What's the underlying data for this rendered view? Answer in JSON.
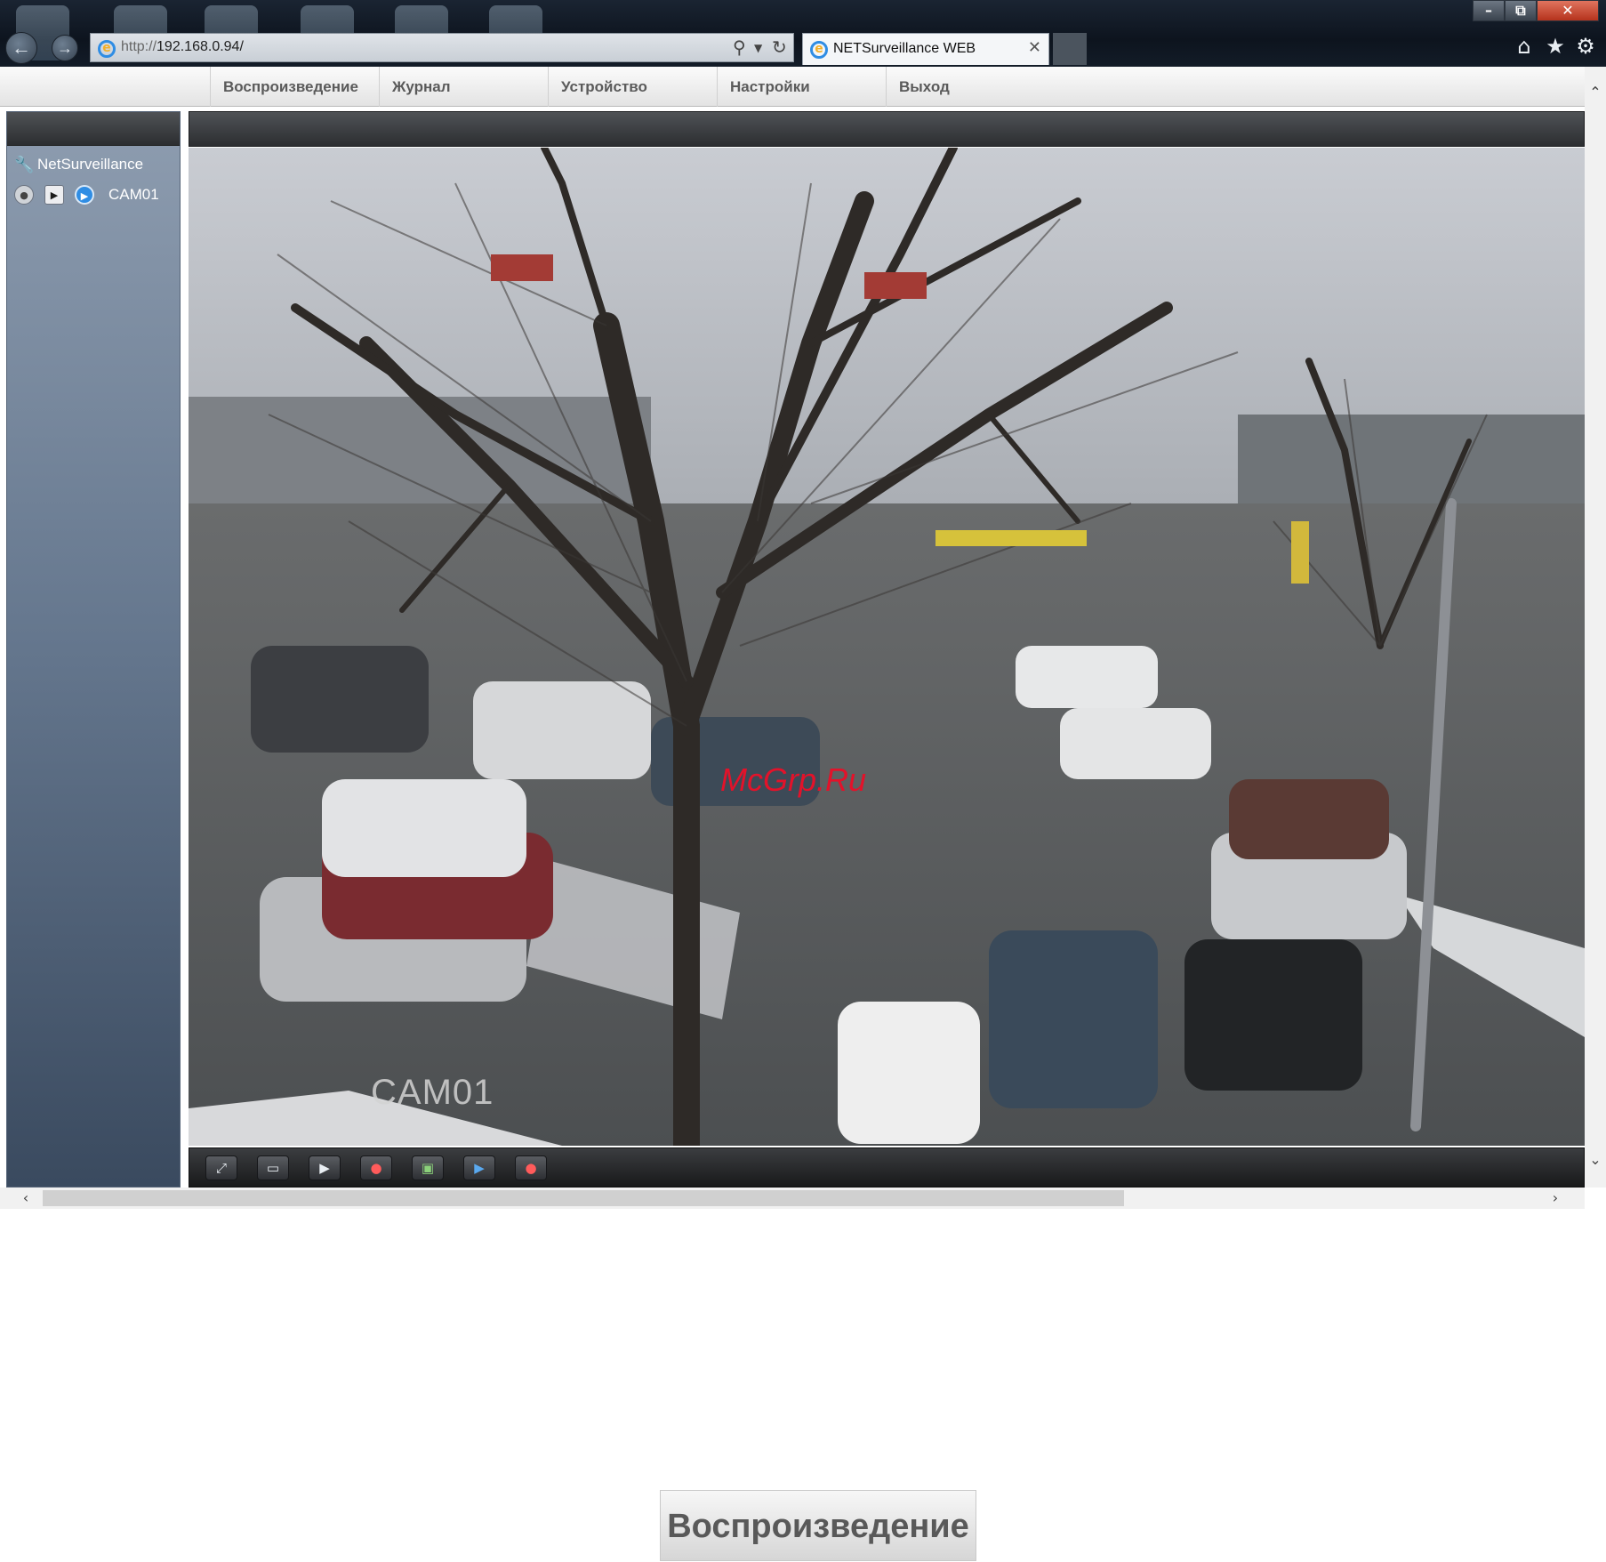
{
  "browser": {
    "url_scheme": "http://",
    "url_host": "192.168.0.94/",
    "tab_title": "NETSurveillance WEB",
    "icons": [
      "back-arrow-icon",
      "forward-arrow-icon",
      "ie-logo-icon",
      "search-icon",
      "dropdown-icon",
      "refresh-icon",
      "close-icon",
      "home-icon",
      "favorites-star-icon",
      "gear-icon",
      "minimize-icon",
      "restore-icon",
      "window-close-icon"
    ]
  },
  "menu": {
    "items": [
      "Воспроизведение",
      "Журнал",
      "Устройство",
      "Настройки",
      "Выход"
    ]
  },
  "sidebar": {
    "root_label": "NetSurveillance",
    "camera_label": "CAM01"
  },
  "video": {
    "osd_text": "CAM01",
    "watermark": "McGrp.Ru"
  },
  "controls": {
    "buttons": [
      "fullscreen-icon",
      "single-window-icon",
      "playback-icon",
      "record-icon",
      "snapshot-icon",
      "camera-play-icon",
      "camera-record-icon"
    ]
  },
  "zoomed_button": {
    "label": "Воспроизведение"
  },
  "colors": {
    "menu_text": "#5a5a5a",
    "sidebar_top": "#8e9db0",
    "sidebar_bottom": "#3a4a5f",
    "watermark": "#e3122a",
    "accent_blue": "#2f8de4"
  }
}
